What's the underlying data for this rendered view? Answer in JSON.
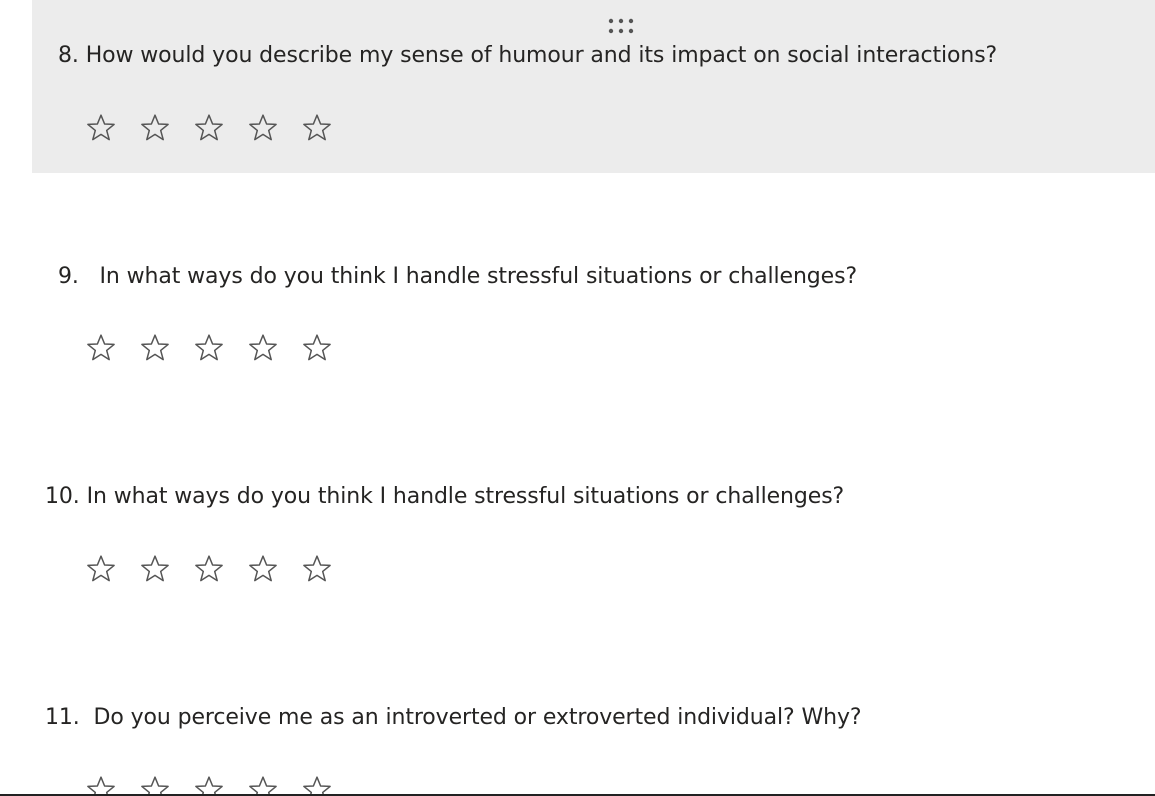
{
  "questions": [
    {
      "number": "8.",
      "text": "How would you describe my sense of humour and its impact on social interactions?",
      "rating_max": 5,
      "rating_value": 0
    },
    {
      "number": "9.",
      "text": "In what ways do you think I handle stressful situations or challenges?",
      "rating_max": 5,
      "rating_value": 0
    },
    {
      "number": "10.",
      "text": "In what ways do you think I handle stressful situations or challenges?",
      "rating_max": 5,
      "rating_value": 0
    },
    {
      "number": "11.",
      "text": "Do you perceive me as an introverted or extroverted individual? Why?",
      "rating_max": 5,
      "rating_value": 0
    }
  ],
  "icons": {
    "drag": "drag-handle-icon",
    "rating": "star-outline-icon"
  },
  "colors": {
    "active_background": "#ececec",
    "text": "#252423",
    "star_outline": "#555555"
  }
}
